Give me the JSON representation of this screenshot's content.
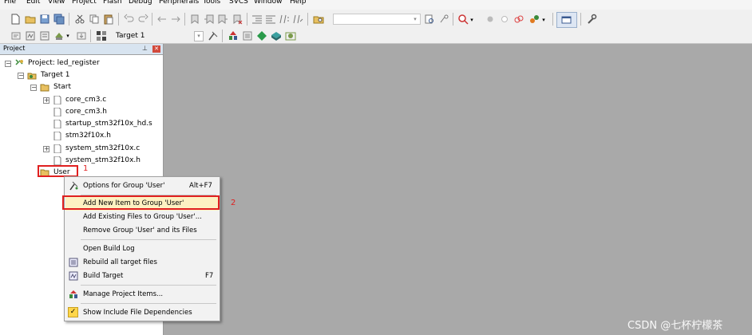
{
  "menu": [
    "File",
    "Edit",
    "View",
    "Project",
    "Flash",
    "Debug",
    "Peripherals",
    "Tools",
    "SVCS",
    "Window",
    "Help"
  ],
  "toolbar": {
    "target_select": "Target 1"
  },
  "panel": {
    "title": "Project"
  },
  "tree": {
    "project": "Project: led_register",
    "target": "Target 1",
    "group_start": "Start",
    "files": [
      "core_cm3.c",
      "core_cm3.h",
      "startup_stm32f10x_hd.s",
      "stm32f10x.h",
      "system_stm32f10x.c",
      "system_stm32f10x.h"
    ],
    "group_user": "User"
  },
  "context_menu": {
    "options": "Options for Group 'User'",
    "options_key": "Alt+F7",
    "add_new": "Add New Item to Group 'User'",
    "add_existing": "Add Existing Files to Group 'User'...",
    "remove": "Remove Group 'User' and its Files",
    "open_log": "Open Build Log",
    "rebuild": "Rebuild all target files",
    "build": "Build Target",
    "build_key": "F7",
    "manage": "Manage Project Items...",
    "show_deps": "Show Include File Dependencies"
  },
  "annotations": {
    "step1": "1",
    "step2": "2"
  },
  "watermark": "CSDN @七杯柠檬茶",
  "colors": {
    "workspace": "#a9a9a9",
    "highlight": "#e02020",
    "selected_item": "#fdf1c2"
  }
}
